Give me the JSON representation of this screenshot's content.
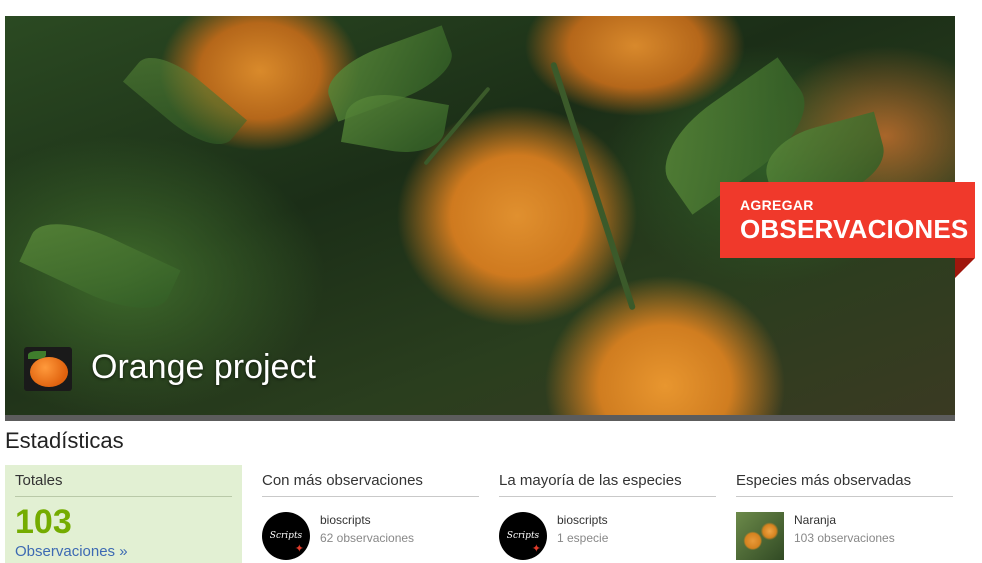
{
  "colors": {
    "accent_green": "#74ac00",
    "button_red": "#f0392b",
    "totals_bg": "#e2f0d3",
    "link_blue": "#3d6ab3"
  },
  "hero": {
    "cta_small": "AGREGAR",
    "cta_big": "OBSERVACIONES",
    "project_title": "Orange project",
    "project_icon": "orange-fruit-icon"
  },
  "stats": {
    "title": "Estadísticas",
    "totals": {
      "label": "Totales",
      "count": "103",
      "link": "Observaciones »"
    },
    "most_observations": {
      "title": "Con más observaciones",
      "user": "bioscripts",
      "detail": "62 observaciones",
      "avatar_text": "Scripts"
    },
    "most_species": {
      "title": "La mayoría de las especies",
      "user": "bioscripts",
      "detail": "1 especie",
      "avatar_text": "Scripts"
    },
    "top_species": {
      "title": "Especies más observadas",
      "name": "Naranja",
      "detail": "103 observaciones"
    }
  }
}
